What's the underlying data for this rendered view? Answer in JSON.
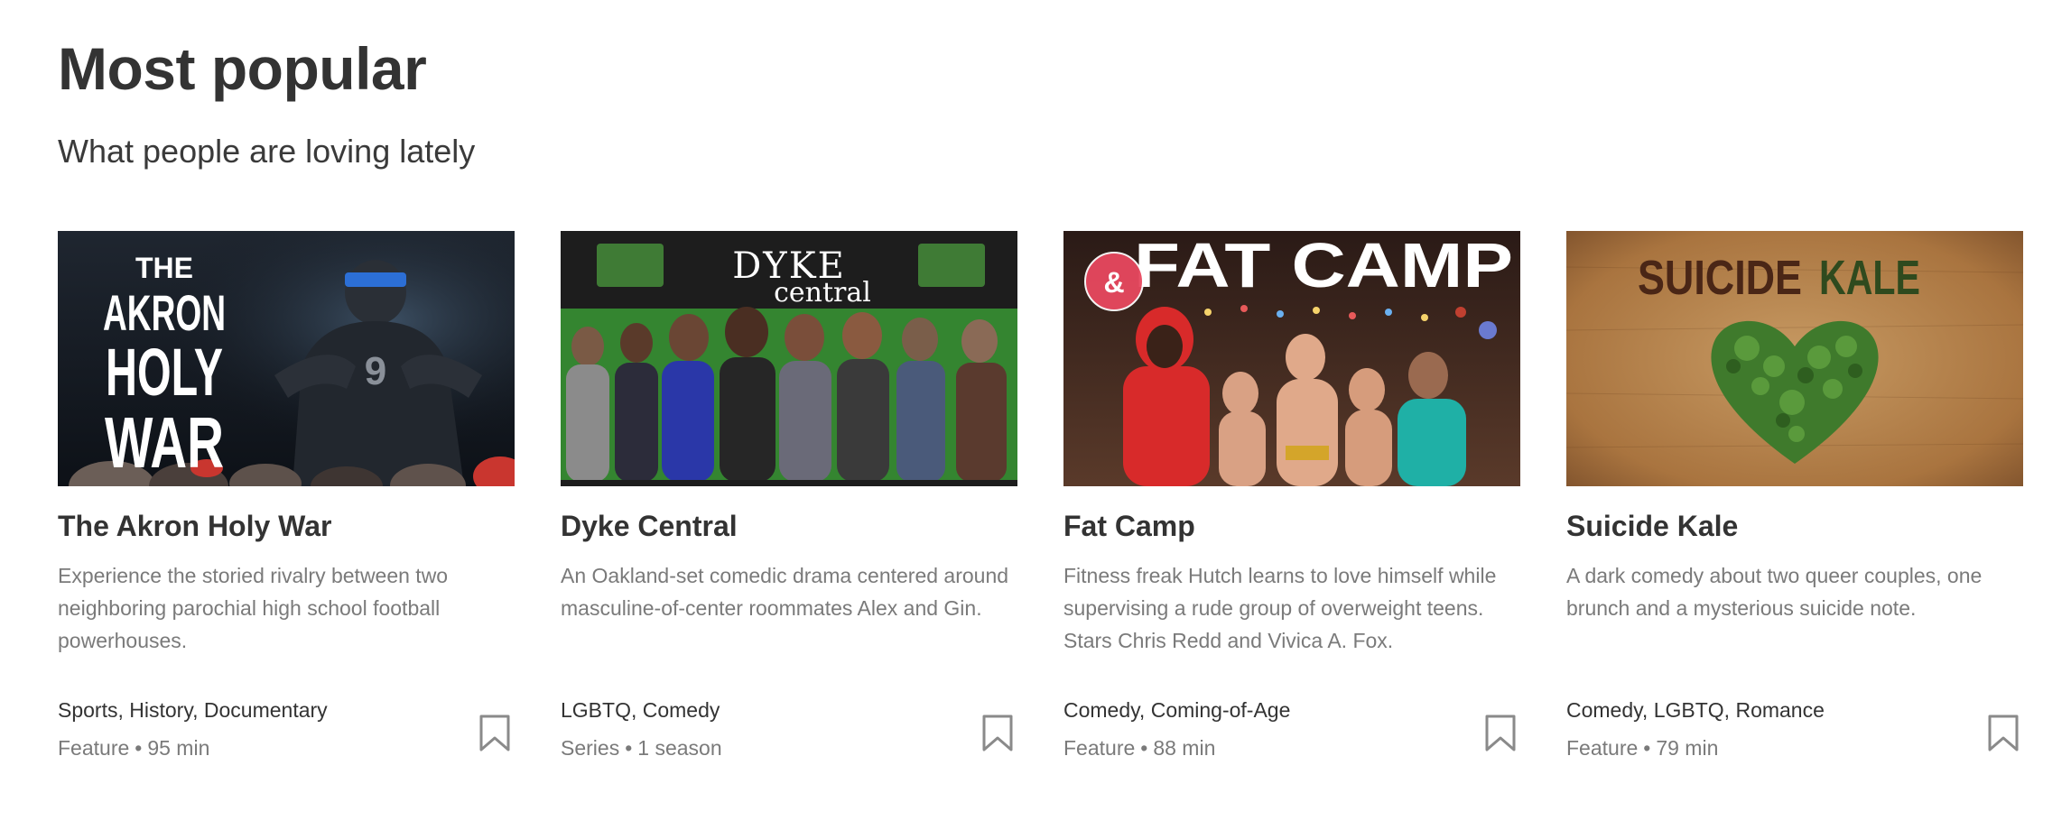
{
  "section": {
    "title": "Most popular",
    "subtitle": "What people are loving lately"
  },
  "cards": [
    {
      "title": "The Akron Holy War",
      "description": "Experience the storied rivalry between two neighboring parochial high school football powerhouses.",
      "genres": "Sports, History, Documentary",
      "type": "Feature",
      "dot": "•",
      "duration": "95 min",
      "poster_text_lines": [
        "THE",
        "AKRON",
        "HOLY",
        "WAR"
      ],
      "jersey_number": "9",
      "bookmark_icon": "bookmark-icon"
    },
    {
      "title": "Dyke Central",
      "description": "An Oakland-set comedic drama centered around masculine-of-center roommates Alex and Gin.",
      "genres": "LGBTQ, Comedy",
      "type": "Series",
      "dot": "•",
      "duration": "1 season",
      "poster_text_top": "DYKE",
      "poster_text_bottom": "central",
      "bookmark_icon": "bookmark-icon"
    },
    {
      "title": "Fat Camp",
      "description": "Fitness freak Hutch learns to love himself while supervising a rude group of overweight teens. Stars Chris Redd and Vivica A. Fox.",
      "genres": "Comedy, Coming-of-Age",
      "type": "Feature",
      "dot": "•",
      "duration": "88 min",
      "poster_text": "FAT CAMP",
      "poster_badge": "&",
      "bookmark_icon": "bookmark-icon"
    },
    {
      "title": "Suicide Kale",
      "description": "A dark comedy about two queer couples, one brunch and a mysterious suicide note.",
      "genres": "Comedy, LGBTQ, Romance",
      "type": "Feature",
      "dot": "•",
      "duration": "79 min",
      "poster_text_a": "SUICIDE",
      "poster_text_b": "KALE",
      "bookmark_icon": "bookmark-icon"
    }
  ],
  "colors": {
    "title": "#333333",
    "body_text": "#7a7a7a",
    "bookmark": "#8a8a8a",
    "poster_badge": "#e8485f"
  }
}
